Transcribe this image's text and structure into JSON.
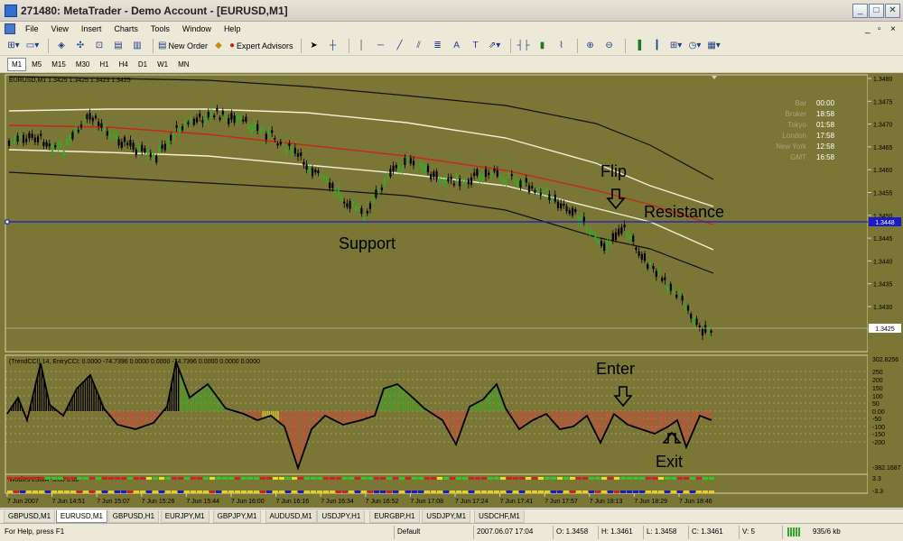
{
  "window": {
    "title": "271480: MetaTrader - Demo Account - [EURUSD,M1]"
  },
  "menu": [
    "File",
    "View",
    "Insert",
    "Charts",
    "Tools",
    "Window",
    "Help"
  ],
  "toolbar": {
    "new_order": "New Order",
    "expert_advisors": "Expert Advisors"
  },
  "timeframes": [
    "M1",
    "M5",
    "M15",
    "M30",
    "H1",
    "H4",
    "D1",
    "W1",
    "MN"
  ],
  "timeframe_active": "M1",
  "main_chart": {
    "header": "EURUSD,M1 1.3425 1.3425 1.3423 1.3425",
    "price_labels": [
      "1.3480",
      "1.3475",
      "1.3470",
      "1.3465",
      "1.3460",
      "1.3455",
      "1.3450",
      "1.3445",
      "1.3440",
      "1.3435",
      "1.3430",
      "1.3425"
    ],
    "support_line_price": "1.3448",
    "current_price": "1.3425",
    "annotations": {
      "support": "Support",
      "resistance": "Resistance",
      "flip": "Flip"
    }
  },
  "clock": [
    {
      "label": "Bar",
      "value": "00:00"
    },
    {
      "label": "Broker",
      "value": "18:58"
    },
    {
      "label": "Tokyo",
      "value": "01:58"
    },
    {
      "label": "London",
      "value": "17:58"
    },
    {
      "label": "New York",
      "value": "12:58"
    },
    {
      "label": "GMT",
      "value": "16:58"
    }
  ],
  "indicator": {
    "header": "(TrendCCI) 14, EntryCCI: 0.0000 -74.7396 0.0000 0.0000 -74.7396 0.0000 0.0000 0.0000",
    "scale": [
      "302.8256",
      "250",
      "200",
      "150",
      "100",
      "50",
      "0.00",
      "-50",
      "-100",
      "-150",
      "-200",
      "-382.1687"
    ],
    "annotations": {
      "enter": "Enter",
      "exit": "Exit"
    }
  },
  "woodies": {
    "header": "Wodies LSMA -3.00 3.00",
    "scale": [
      "3.3",
      "-3.3"
    ]
  },
  "time_labels": [
    "7 Jun 2007",
    "7 Jun 14:51",
    "7 Jun 15:07",
    "7 Jun 15:26",
    "7 Jun 15:44",
    "7 Jun 16:00",
    "7 Jun 16:16",
    "7 Jun 16:34",
    "7 Jun 16:52",
    "7 Jun 17:08",
    "7 Jun 17:24",
    "7 Jun 17:41",
    "7 Jun 17:57",
    "7 Jun 18:13",
    "7 Jun 18:29",
    "7 Jun 18:46"
  ],
  "tabs": [
    "GBPUSD,M1",
    "EURUSD,M1",
    "GBPUSD,H1",
    "EURJPY,M1",
    "GBPJPY,M1",
    "AUDUSD,M1",
    "USDJPY,H1",
    "EURGBP,H1",
    "USDJPY,M1",
    "USDCHF,M1"
  ],
  "tab_active": "EURUSD,M1",
  "status": {
    "help": "For Help, press F1",
    "profile": "Default",
    "datetime": "2007.06.07 17:04",
    "open": "O: 1.3458",
    "high": "H: 1.3461",
    "low": "L: 1.3458",
    "close": "C: 1.3461",
    "volume": "V: 5",
    "traffic": "935/6 kb"
  },
  "colors": {
    "chart_bg": "#7a7636",
    "support_line": "#1a1ac8",
    "ma_red": "#c8281c",
    "bull_candle": "#3aa82a",
    "bear_candle": "#000000"
  }
}
